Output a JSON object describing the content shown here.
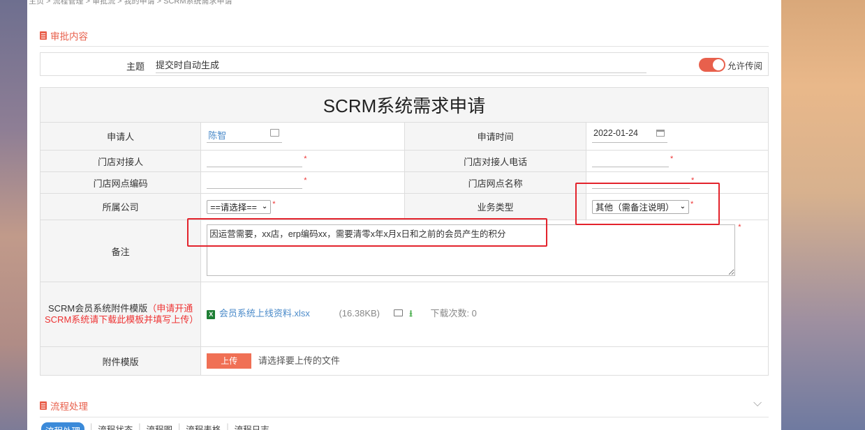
{
  "breadcrumb": "主页 > 流程管理 > 审批流 > 我的申请 > SCRM系统需求申请",
  "approval_section": {
    "title": "审批内容"
  },
  "subject": {
    "label": "主题",
    "value": "提交时自动生成",
    "toggle_label": "允许传阅",
    "toggle_on": true
  },
  "form": {
    "title": "SCRM系统需求申请",
    "applicant_label": "申请人",
    "applicant_value": "陈智",
    "apply_time_label": "申请时间",
    "apply_time_value": "2022-01-24",
    "store_contact_label": "门店对接人",
    "store_contact_phone_label": "门店对接人电话",
    "store_code_label": "门店网点编码",
    "store_name_label": "门店网点名称",
    "company_label": "所属公司",
    "company_select": "==请选择==",
    "biz_type_label": "业务类型",
    "biz_type_select": "其他（需备注说明）",
    "remark_label": "备注",
    "remark_value": "因运营需要，xx店，erp编码xx，需要清零x年x月x日和之前的会员产生的积分",
    "template_label": "SCRM会员系统附件模版",
    "template_note": "（申请开通SCRM系统请下载此模板并填写上传）",
    "template_file": "会员系统上线资料.xlsx",
    "template_size": "(16.38KB)",
    "download_count": "下载次数: 0",
    "attach_label": "附件模版",
    "upload_button": "上传",
    "upload_hint": "请选择要上传的文件",
    "required_mark": "*"
  },
  "process_section": {
    "title": "流程处理"
  },
  "tabs": [
    "流程处理",
    "流程状态",
    "流程图",
    "流程表格",
    "流程日志"
  ],
  "colors": {
    "accent": "#e8604c",
    "link": "#4a8ac9",
    "highlight": "#e3232c",
    "tab_active": "#3b8ad9"
  }
}
